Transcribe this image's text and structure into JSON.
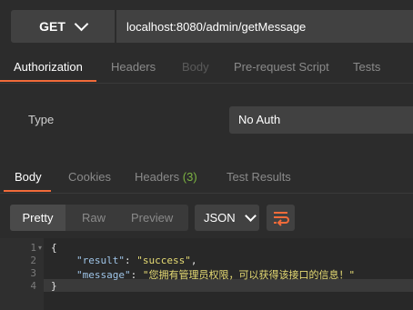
{
  "request": {
    "method": "GET",
    "url": "localhost:8080/admin/getMessage"
  },
  "request_tabs": [
    {
      "label": "Authorization",
      "state": "active"
    },
    {
      "label": "Headers",
      "state": "normal"
    },
    {
      "label": "Body",
      "state": "disabled"
    },
    {
      "label": "Pre-request Script",
      "state": "normal"
    },
    {
      "label": "Tests",
      "state": "normal"
    }
  ],
  "auth": {
    "type_label": "Type",
    "type_value": "No Auth"
  },
  "response_tabs": {
    "body": "Body",
    "cookies": "Cookies",
    "headers": "Headers",
    "headers_count": "(3)",
    "test_results": "Test Results"
  },
  "response_toolbar": {
    "pretty": "Pretty",
    "raw": "Raw",
    "preview": "Preview",
    "format": "JSON"
  },
  "code": {
    "line_numbers": [
      "1",
      "2",
      "3",
      "4"
    ],
    "open_brace": "{",
    "close_brace": "}",
    "fields": [
      {
        "key": "\"result\"",
        "value": "\"success\"",
        "trail": ","
      },
      {
        "key": "\"message\"",
        "value": "\"您拥有管理员权限，可以获得该接口的信息！\"",
        "trail": ""
      }
    ]
  },
  "colors": {
    "accent": "#f26b3a",
    "count_green": "#7cb342",
    "json_key": "#9fc5e8",
    "json_string": "#e6db74"
  }
}
